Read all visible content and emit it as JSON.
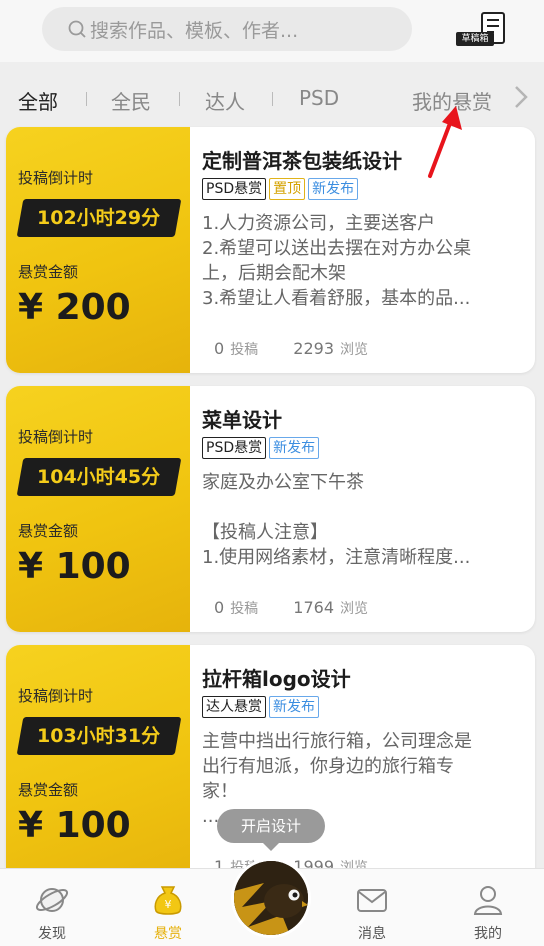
{
  "search": {
    "placeholder": "搜索作品、模板、作者..."
  },
  "draft_box": {
    "label": "草稿箱"
  },
  "tabs": [
    {
      "label": "全部",
      "active": true
    },
    {
      "label": "全民",
      "active": false
    },
    {
      "label": "达人",
      "active": false
    },
    {
      "label": "PSD",
      "active": false
    }
  ],
  "tab_more": {
    "label": "我的悬赏"
  },
  "cards": [
    {
      "countdown_label": "投稿倒计时",
      "countdown": "102小时29分",
      "amount_label": "悬赏金额",
      "amount": "¥ 200",
      "title": "定制普洱茶包装纸设计",
      "tags": [
        {
          "text": "PSD悬赏",
          "style": "dark"
        },
        {
          "text": "置顶",
          "style": "gold"
        },
        {
          "text": "新发布",
          "style": "blue"
        }
      ],
      "desc": [
        "1.人力资源公司，主要送客户",
        "2.希望可以送出去摆在对方办公桌",
        "上，后期会配木架",
        "3.希望让人看着舒服，基本的品..."
      ],
      "submissions": "0",
      "submissions_unit": "投稿",
      "views": "2293",
      "views_unit": "浏览"
    },
    {
      "countdown_label": "投稿倒计时",
      "countdown": "104小时45分",
      "amount_label": "悬赏金额",
      "amount": "¥ 100",
      "title": "菜单设计",
      "tags": [
        {
          "text": "PSD悬赏",
          "style": "dark"
        },
        {
          "text": "新发布",
          "style": "blue"
        }
      ],
      "desc": [
        "家庭及办公室下午茶",
        "",
        "【投稿人注意】",
        "1.使用网络素材，注意清晰程度..."
      ],
      "submissions": "0",
      "submissions_unit": "投稿",
      "views": "1764",
      "views_unit": "浏览"
    },
    {
      "countdown_label": "投稿倒计时",
      "countdown": "103小时31分",
      "amount_label": "悬赏金额",
      "amount": "¥ 100",
      "title": "拉杆箱logo设计",
      "tags": [
        {
          "text": "达人悬赏",
          "style": "dark"
        },
        {
          "text": "新发布",
          "style": "blue"
        }
      ],
      "desc": [
        "主营中挡出行旅行箱，公司理念是",
        "出行有旭派，你身边的旅行箱专",
        "家！",
        "..."
      ],
      "submissions": "1",
      "submissions_unit": "投稿",
      "views": "1999",
      "views_unit": "浏览"
    }
  ],
  "floating_pill": {
    "label": "开启设计"
  },
  "bottom_nav": [
    {
      "label": "发现",
      "icon": "planet-icon",
      "active": false
    },
    {
      "label": "悬赏",
      "icon": "money-bag-icon",
      "active": true
    },
    {
      "label": "消息",
      "icon": "envelope-icon",
      "active": false
    },
    {
      "label": "我的",
      "icon": "person-icon",
      "active": false
    }
  ],
  "colors": {
    "accent": "#f2c714",
    "dark": "#1c1c1c",
    "tag_blue": "#3c8ee0",
    "tag_gold": "#d4a200",
    "annotation": "#e8141c"
  }
}
